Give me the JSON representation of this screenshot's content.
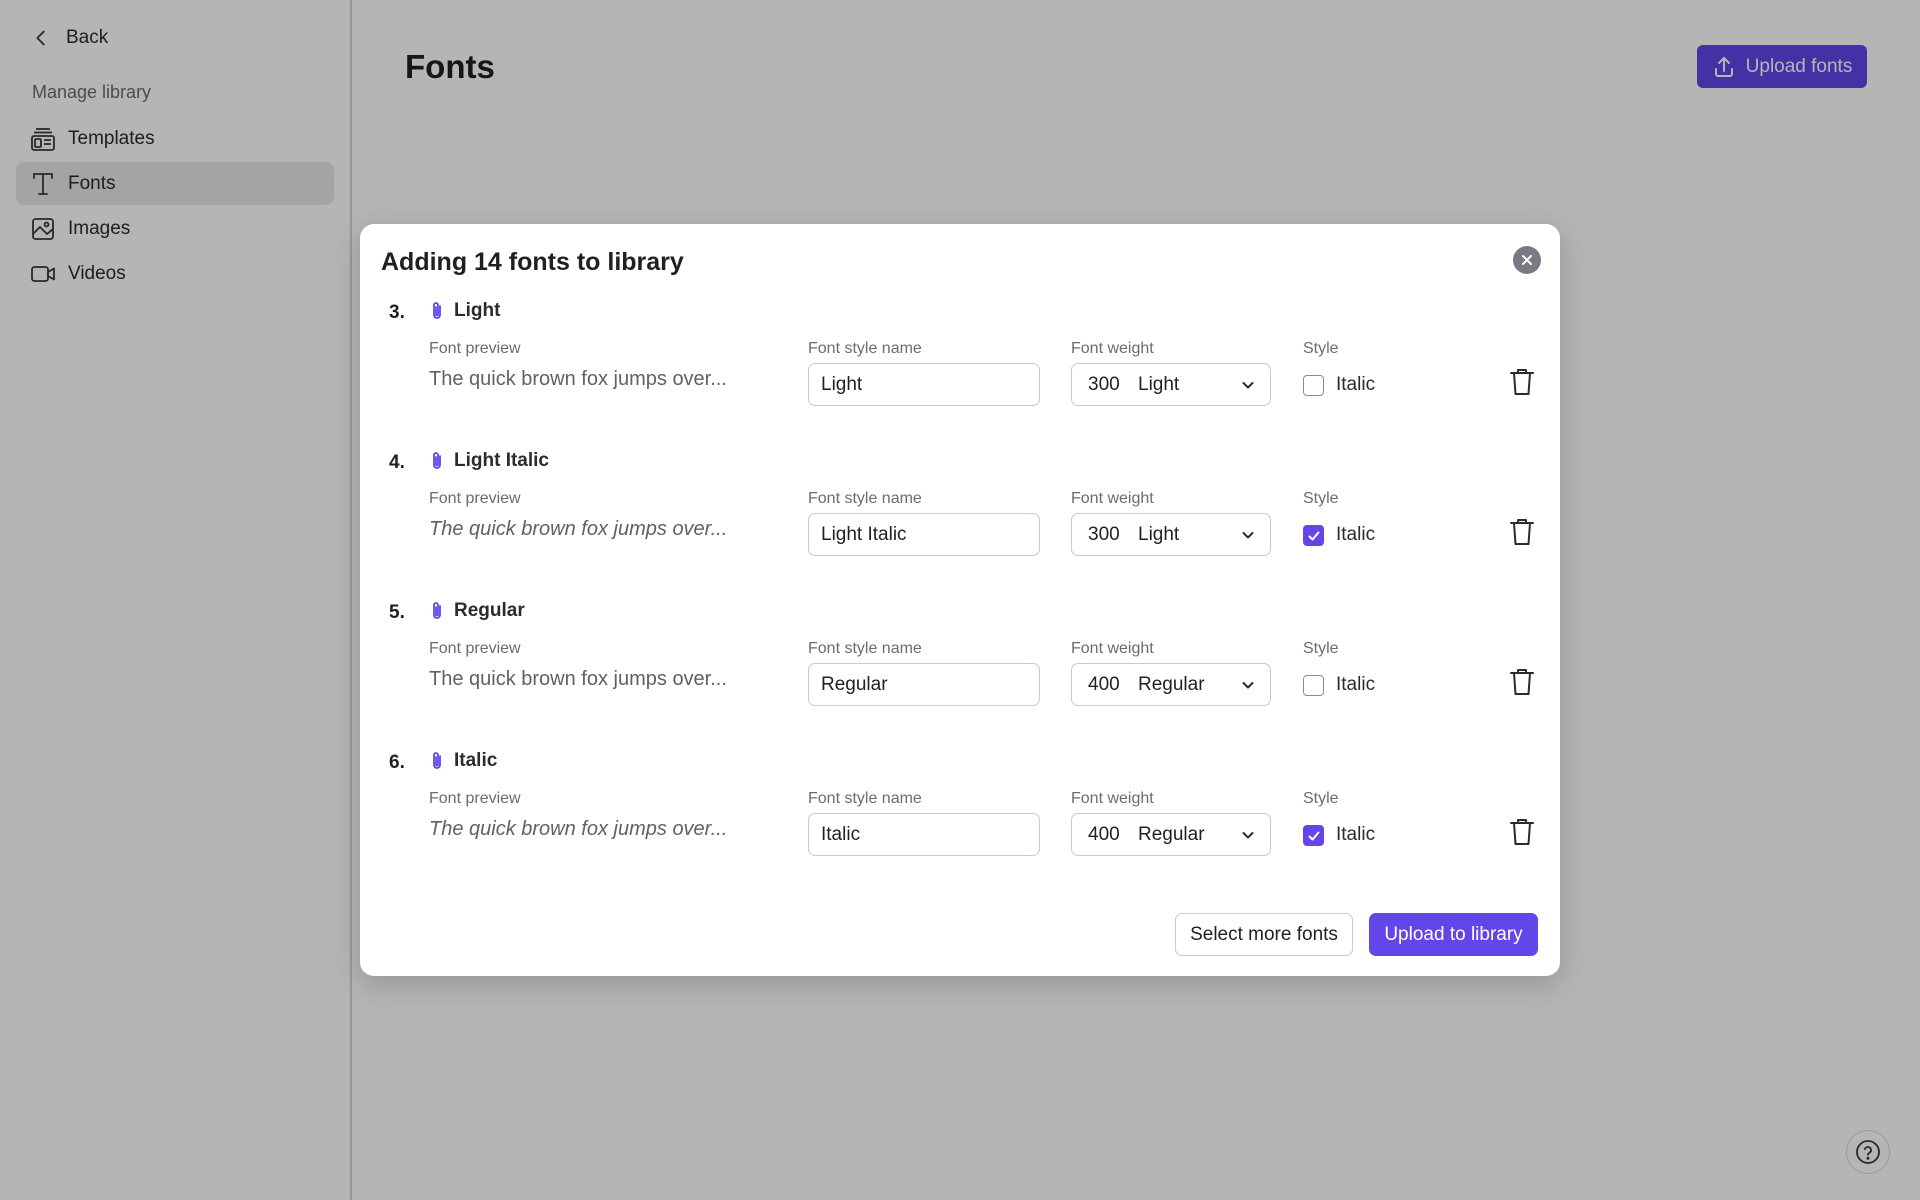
{
  "sidebar": {
    "back_label": "Back",
    "section_label": "Manage library",
    "items": [
      {
        "label": "Templates",
        "icon": "templates-icon"
      },
      {
        "label": "Fonts",
        "icon": "text-icon",
        "active": true
      },
      {
        "label": "Images",
        "icon": "image-icon"
      },
      {
        "label": "Videos",
        "icon": "video-icon"
      }
    ]
  },
  "header": {
    "title": "Fonts",
    "upload_label": "Upload fonts"
  },
  "modal": {
    "title": "Adding 14 fonts to library",
    "labels": {
      "preview": "Font preview",
      "style_name": "Font style name",
      "weight": "Font weight",
      "style": "Style"
    },
    "rows": [
      {
        "num": "3.",
        "file": "Light",
        "preview": "The quick brown fox jumps over...",
        "style_name": "Light",
        "weight_value": "300",
        "weight_name": "Light",
        "italic_label": "Italic",
        "italic": false
      },
      {
        "num": "4.",
        "file": "Light Italic",
        "preview": "The quick brown fox jumps over...",
        "style_name": "Light Italic",
        "weight_value": "300",
        "weight_name": "Light",
        "italic_label": "Italic",
        "italic": true
      },
      {
        "num": "5.",
        "file": "Regular",
        "preview": "The quick brown fox jumps over...",
        "style_name": "Regular",
        "weight_value": "400",
        "weight_name": "Regular",
        "italic_label": "Italic",
        "italic": false
      },
      {
        "num": "6.",
        "file": "Italic",
        "preview": "The quick brown fox jumps over...",
        "style_name": "Italic",
        "weight_value": "400",
        "weight_name": "Regular",
        "italic_label": "Italic",
        "italic": true
      }
    ],
    "select_more_label": "Select more fonts",
    "upload_label": "Upload to library"
  },
  "colors": {
    "accent": "#6246ea",
    "overlay": "rgba(0,0,0,0.29)"
  }
}
